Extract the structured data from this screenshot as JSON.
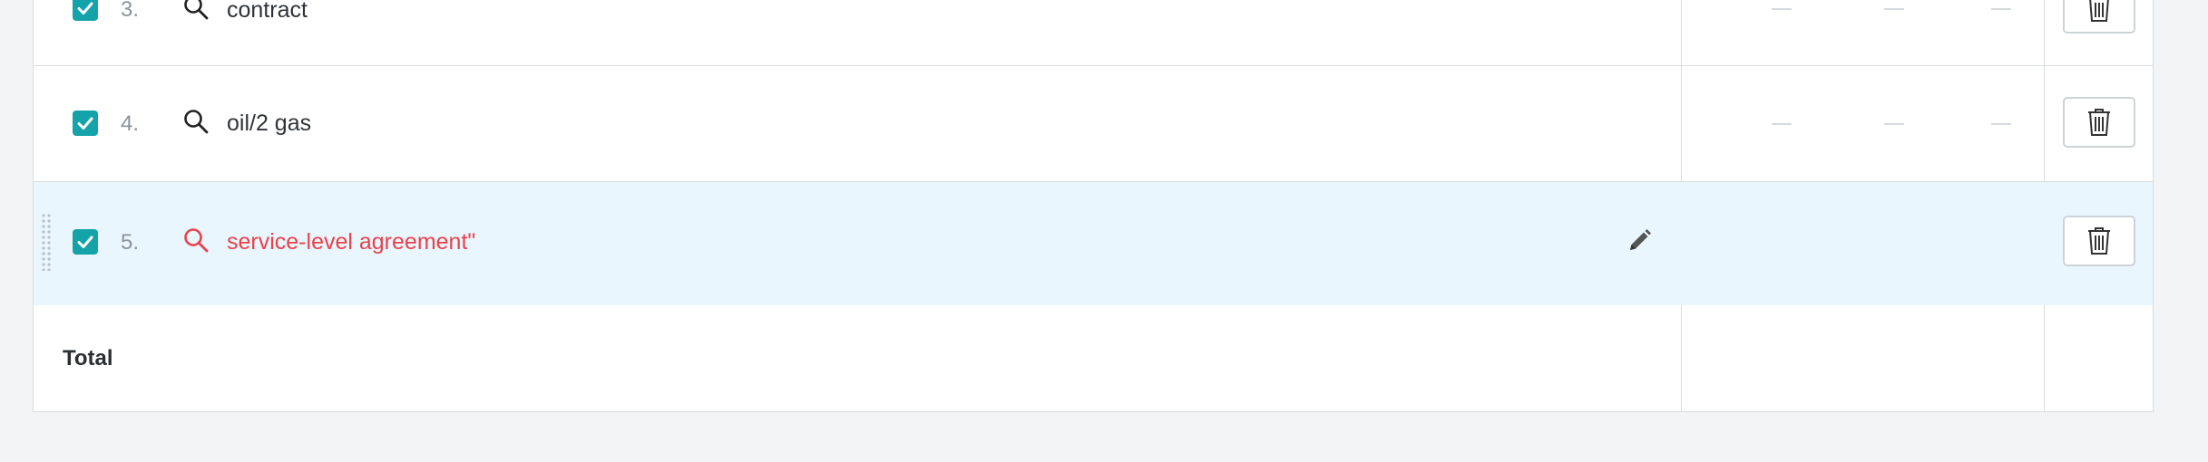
{
  "colors": {
    "checkbox": "#14a3a8",
    "highlight_row": "#eaf6fd",
    "error_text": "#e8424c",
    "border": "#d9dde1"
  },
  "rows": [
    {
      "index": "3.",
      "term": "contract",
      "checked": true,
      "icon": "search-icon",
      "stats": [
        "—",
        "—",
        "—"
      ]
    },
    {
      "index": "4.",
      "term": "oil/2 gas",
      "checked": true,
      "icon": "search-icon",
      "stats": [
        "—",
        "—",
        "—"
      ]
    },
    {
      "index": "5.",
      "term": "service-level agreement\"",
      "checked": true,
      "icon": "search-icon",
      "state": "error",
      "editable": true
    }
  ],
  "footer": {
    "total_label": "Total"
  },
  "icons": {
    "delete": "trash-icon",
    "edit": "pencil-icon",
    "drag": "drag-handle-icon",
    "check": "check-icon"
  }
}
